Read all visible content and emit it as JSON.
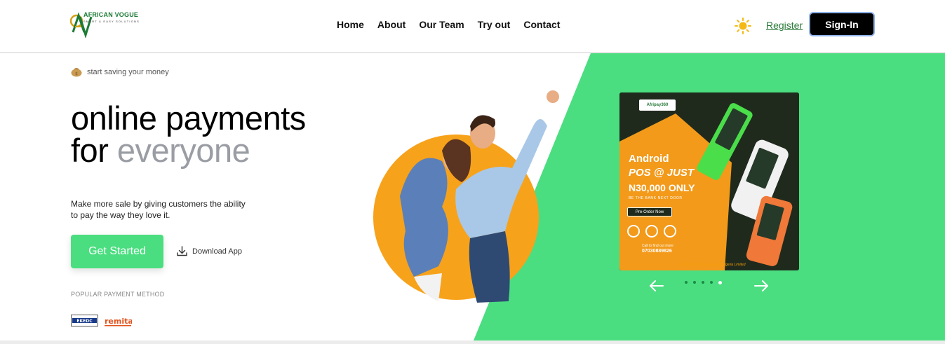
{
  "brand": {
    "name": "AFRICAN VOGUE",
    "tagline": "SMART & EASY SOLUTIONS",
    "initials": "AV"
  },
  "nav": {
    "items": [
      "Home",
      "About",
      "Our Team",
      "Try out",
      "Contact"
    ]
  },
  "header": {
    "register_label": "Register",
    "signin_label": "Sign-In"
  },
  "hero": {
    "tag": "start saving your money",
    "headline_line1": "online payments",
    "headline_line2_a": "for ",
    "headline_line2_b": "everyone",
    "description": "Make more sale by giving customers the ability to pay the way they love it.",
    "cta_label": "Get Started",
    "download_label": "Download App",
    "popular_label": "POPULAR PAYMENT METHOD",
    "payment_methods": [
      "EKEDC",
      "remita"
    ]
  },
  "promo": {
    "brand": "Afripay360",
    "line1": "Android",
    "line2": "POS @ JUST",
    "line3": "N30,000 ONLY",
    "line4": "BE THE BANK NEXT DOOR",
    "cta": "Pre-Order Now",
    "call_label": "Call to find out more",
    "phone": "07030889826",
    "footer": "Powered by African Vogue Nigeria Limited"
  },
  "carousel": {
    "slide_count": 5,
    "active_index": 4
  },
  "colors": {
    "accent_green": "#4ade80",
    "headline_grey": "#9a9da4",
    "promo_orange": "#f39a1a",
    "circle_orange": "#f7a21b"
  },
  "icons": {
    "theme_toggle": "sun-icon",
    "tag": "money-bag-icon",
    "download": "download-icon",
    "prev": "arrow-left-icon",
    "next": "arrow-right-icon"
  }
}
